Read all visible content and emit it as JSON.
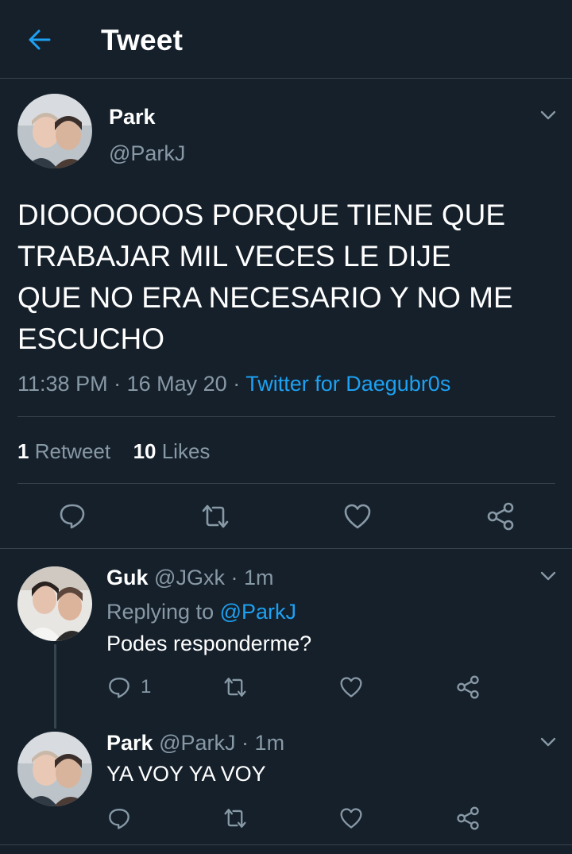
{
  "header": {
    "title": "Tweet"
  },
  "main_tweet": {
    "name": "Park",
    "handle": "@ParkJ",
    "text_lines": [
      "DIOOOOOOS PORQUE TIENE QUE",
      "TRABAJAR MIL VECES LE DIJE",
      "QUE NO ERA NECESARIO Y NO ME",
      "ESCUCHO"
    ],
    "time": "11:38 PM",
    "date": "16 May 20",
    "sep": "·",
    "source": "Twitter for Daegubr0s",
    "retweet_count": "1",
    "retweet_label": "Retweet",
    "like_count": "10",
    "like_label": "Likes"
  },
  "replies": [
    {
      "name": "Guk",
      "handle": "@JGxk",
      "time_sep": "·",
      "time": "1m",
      "replying_prefix": "Replying to",
      "replying_to": "@ParkJ",
      "text": "Podes responderme?",
      "reply_count": "1"
    },
    {
      "name": "Park",
      "handle": "@ParkJ",
      "time_sep": "·",
      "time": "1m",
      "text": "YA VOY YA VOY"
    }
  ],
  "colors": {
    "background": "#15202b",
    "divider": "#38444d",
    "muted": "#8899a6",
    "accent": "#1da1f2"
  }
}
